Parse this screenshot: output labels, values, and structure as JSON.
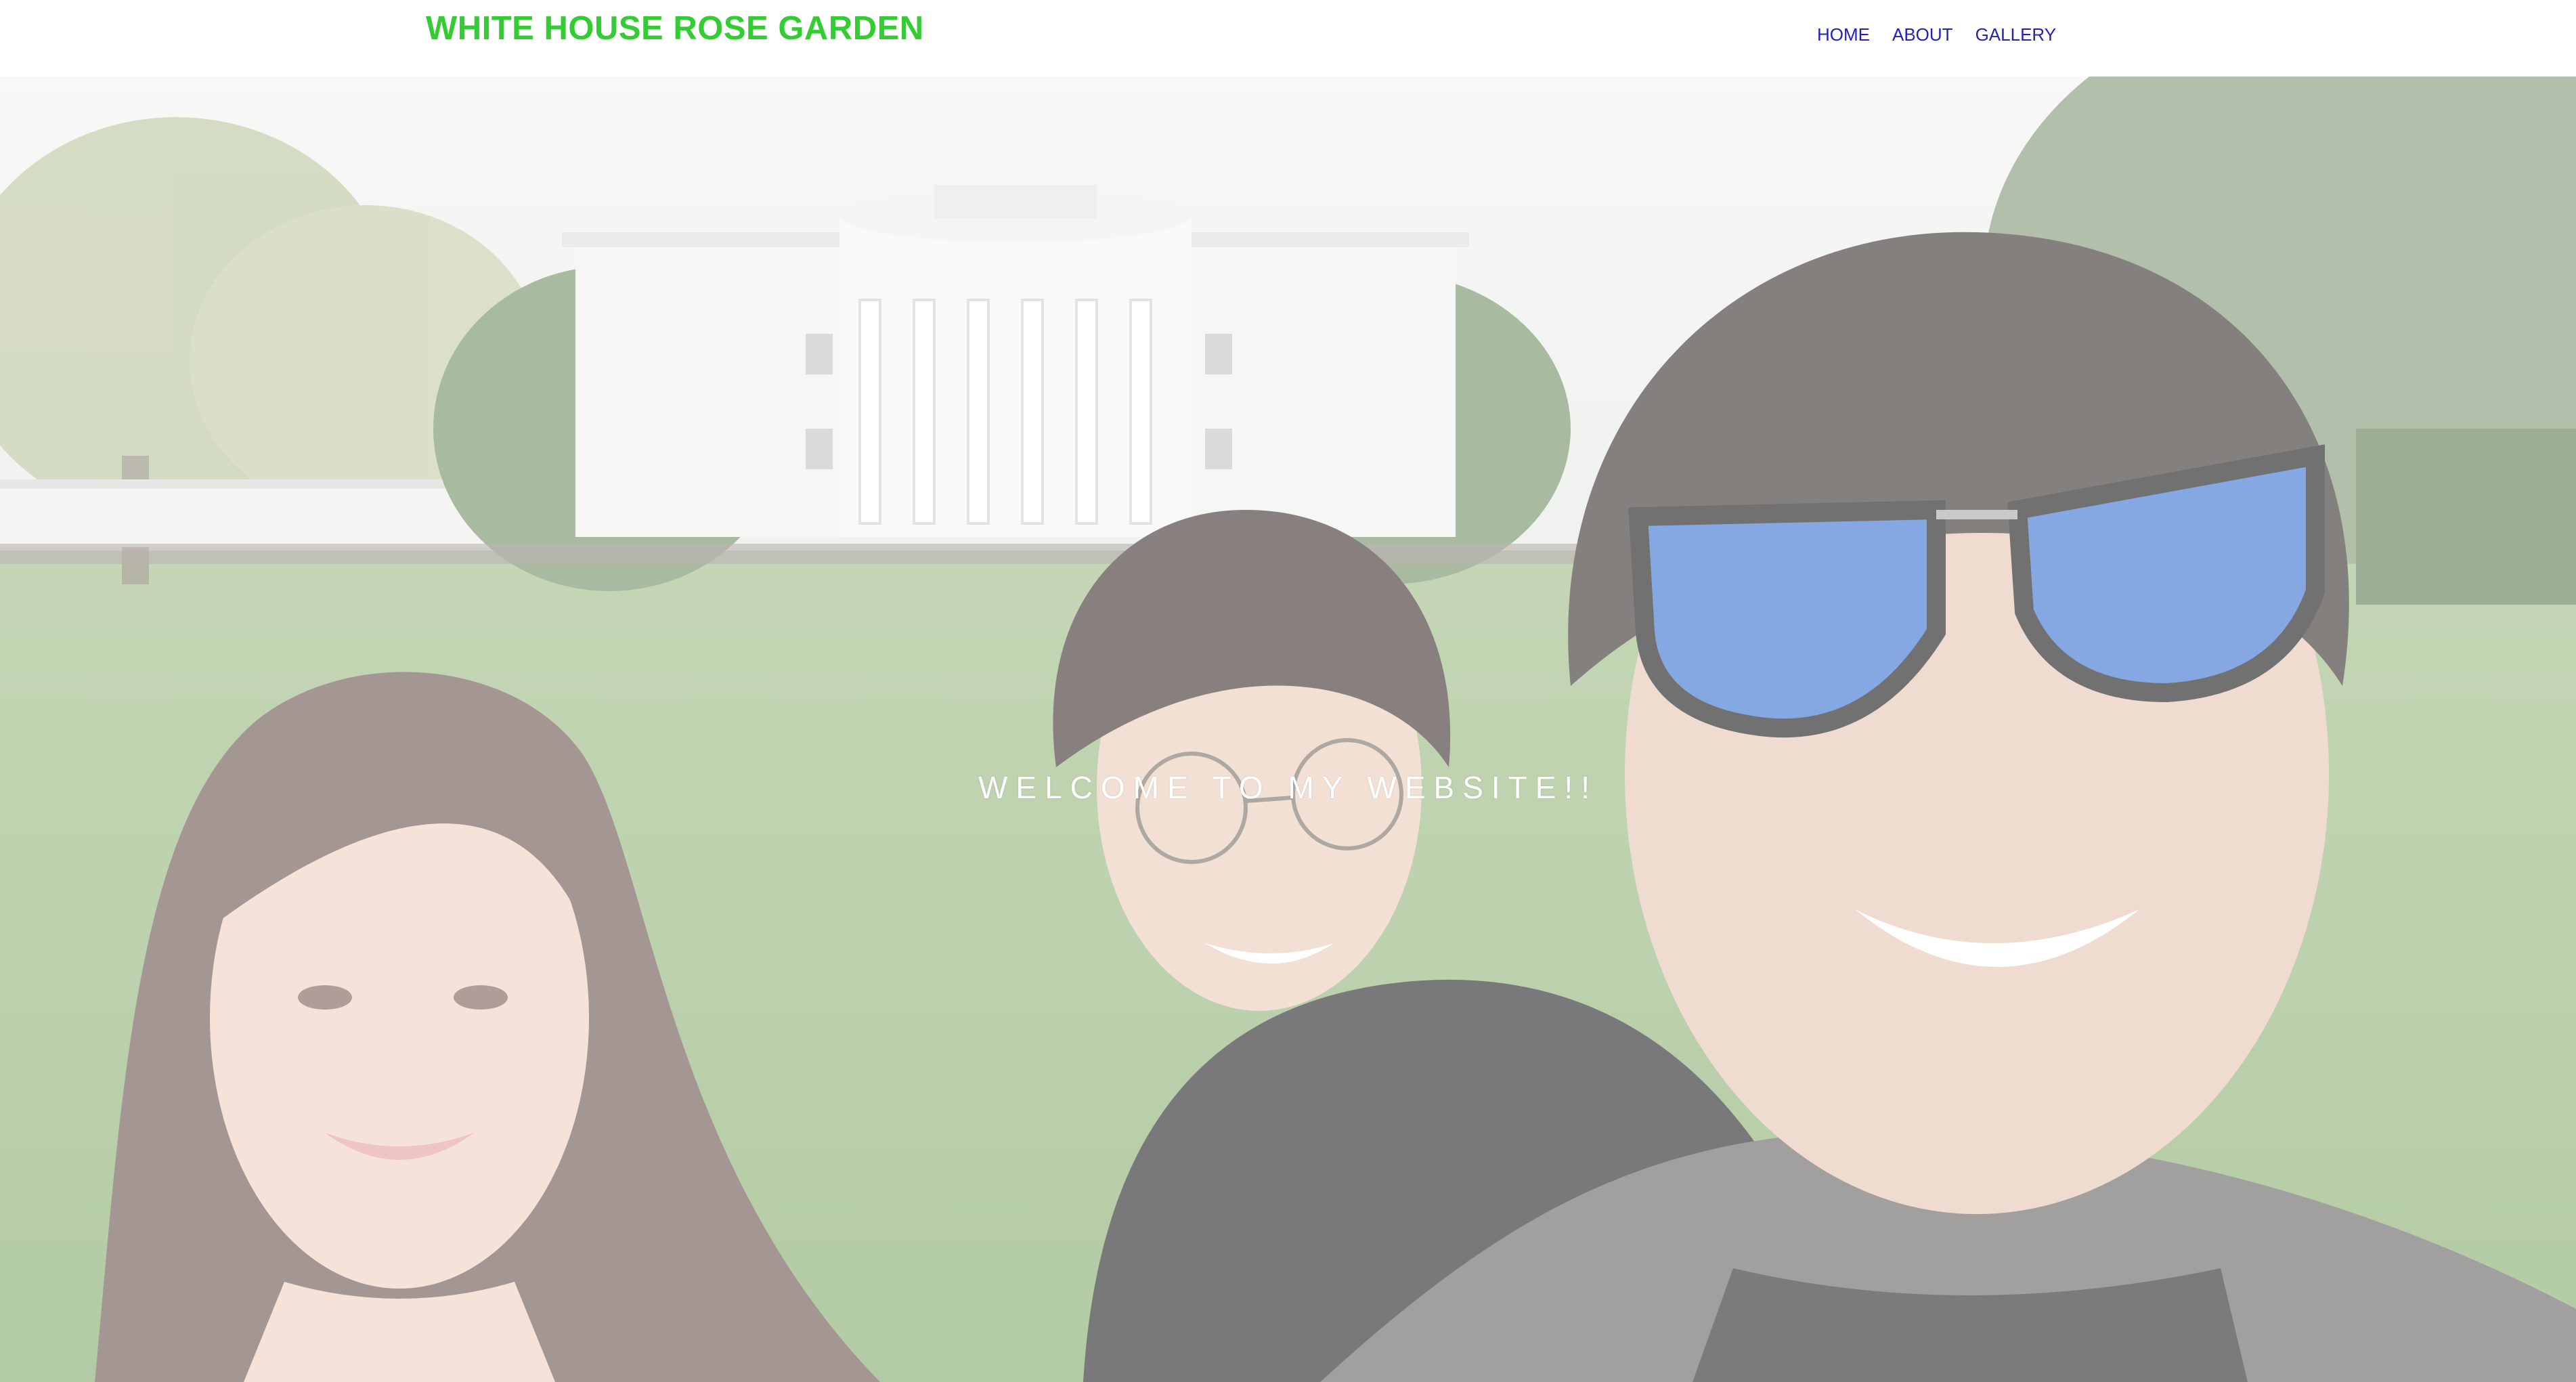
{
  "site": {
    "title": "WHITE HOUSE ROSE GARDEN",
    "title_color": "#33cc33"
  },
  "nav": {
    "items": [
      {
        "label": "HOME"
      },
      {
        "label": "ABOUT"
      },
      {
        "label": "GALLERY"
      }
    ],
    "link_color": "#2222bb"
  },
  "hero": {
    "heading": "WELCOME TO MY WEBSITE!!",
    "image_subject": "selfie-photo-white-house-lawn"
  }
}
